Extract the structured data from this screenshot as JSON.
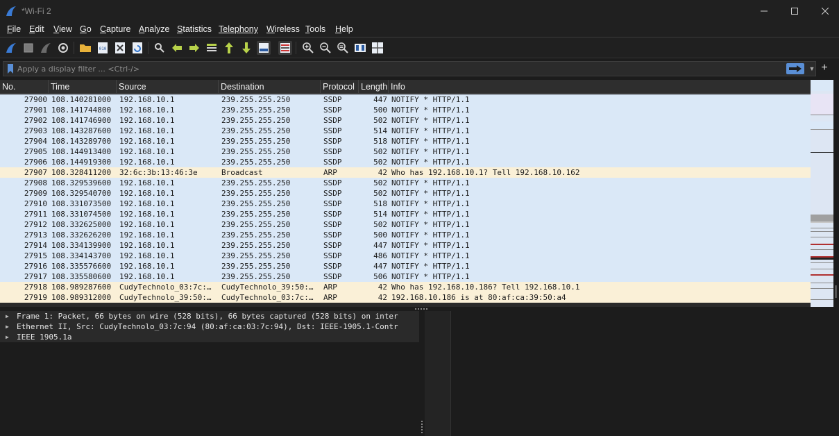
{
  "window": {
    "title": "*Wi-Fi 2"
  },
  "menu": [
    {
      "label": "File",
      "u": "F",
      "rest": "ile",
      "id": "file"
    },
    {
      "label": "Edit",
      "u": "E",
      "rest": "dit",
      "id": "edit"
    },
    {
      "label": "View",
      "u": "V",
      "rest": "iew",
      "id": "view"
    },
    {
      "label": "Go",
      "u": "G",
      "rest": "o",
      "id": "go"
    },
    {
      "label": "Capture",
      "u": "C",
      "rest": "apture",
      "id": "capture"
    },
    {
      "label": "Analyze",
      "u": "A",
      "rest": "nalyze",
      "id": "analyze"
    },
    {
      "label": "Statistics",
      "u": "S",
      "rest": "tatistics",
      "id": "statistics"
    },
    {
      "label": "Telephony",
      "u": "",
      "rest": "Telephony",
      "id": "telephony"
    },
    {
      "label": "Wireless",
      "u": "W",
      "rest": "ireless",
      "id": "wireless"
    },
    {
      "label": "Tools",
      "u": "T",
      "rest": "ools",
      "id": "tools"
    },
    {
      "label": "Help",
      "u": "H",
      "rest": "elp",
      "id": "help"
    }
  ],
  "filter": {
    "placeholder": "Apply a display filter ... <Ctrl-/>"
  },
  "columns": {
    "no": "No.",
    "time": "Time",
    "source": "Source",
    "destination": "Destination",
    "protocol": "Protocol",
    "length": "Length",
    "info": "Info"
  },
  "packets": [
    {
      "no": "27900",
      "time": "108.140281000",
      "src": "192.168.10.1",
      "dst": "239.255.255.250",
      "proto": "SSDP",
      "len": "447",
      "info": "NOTIFY * HTTP/1.1"
    },
    {
      "no": "27901",
      "time": "108.141744800",
      "src": "192.168.10.1",
      "dst": "239.255.255.250",
      "proto": "SSDP",
      "len": "500",
      "info": "NOTIFY * HTTP/1.1"
    },
    {
      "no": "27902",
      "time": "108.141746900",
      "src": "192.168.10.1",
      "dst": "239.255.255.250",
      "proto": "SSDP",
      "len": "502",
      "info": "NOTIFY * HTTP/1.1"
    },
    {
      "no": "27903",
      "time": "108.143287600",
      "src": "192.168.10.1",
      "dst": "239.255.255.250",
      "proto": "SSDP",
      "len": "514",
      "info": "NOTIFY * HTTP/1.1"
    },
    {
      "no": "27904",
      "time": "108.143289700",
      "src": "192.168.10.1",
      "dst": "239.255.255.250",
      "proto": "SSDP",
      "len": "518",
      "info": "NOTIFY * HTTP/1.1"
    },
    {
      "no": "27905",
      "time": "108.144913400",
      "src": "192.168.10.1",
      "dst": "239.255.255.250",
      "proto": "SSDP",
      "len": "502",
      "info": "NOTIFY * HTTP/1.1"
    },
    {
      "no": "27906",
      "time": "108.144919300",
      "src": "192.168.10.1",
      "dst": "239.255.255.250",
      "proto": "SSDP",
      "len": "502",
      "info": "NOTIFY * HTTP/1.1"
    },
    {
      "no": "27907",
      "time": "108.328411200",
      "src": "32:6c:3b:13:46:3e",
      "dst": "Broadcast",
      "proto": "ARP",
      "len": "42",
      "info": "Who has 192.168.10.1? Tell 192.168.10.162"
    },
    {
      "no": "27908",
      "time": "108.329539600",
      "src": "192.168.10.1",
      "dst": "239.255.255.250",
      "proto": "SSDP",
      "len": "502",
      "info": "NOTIFY * HTTP/1.1"
    },
    {
      "no": "27909",
      "time": "108.329540700",
      "src": "192.168.10.1",
      "dst": "239.255.255.250",
      "proto": "SSDP",
      "len": "502",
      "info": "NOTIFY * HTTP/1.1"
    },
    {
      "no": "27910",
      "time": "108.331073500",
      "src": "192.168.10.1",
      "dst": "239.255.255.250",
      "proto": "SSDP",
      "len": "518",
      "info": "NOTIFY * HTTP/1.1"
    },
    {
      "no": "27911",
      "time": "108.331074500",
      "src": "192.168.10.1",
      "dst": "239.255.255.250",
      "proto": "SSDP",
      "len": "514",
      "info": "NOTIFY * HTTP/1.1"
    },
    {
      "no": "27912",
      "time": "108.332625000",
      "src": "192.168.10.1",
      "dst": "239.255.255.250",
      "proto": "SSDP",
      "len": "502",
      "info": "NOTIFY * HTTP/1.1"
    },
    {
      "no": "27913",
      "time": "108.332626200",
      "src": "192.168.10.1",
      "dst": "239.255.255.250",
      "proto": "SSDP",
      "len": "500",
      "info": "NOTIFY * HTTP/1.1"
    },
    {
      "no": "27914",
      "time": "108.334139900",
      "src": "192.168.10.1",
      "dst": "239.255.255.250",
      "proto": "SSDP",
      "len": "447",
      "info": "NOTIFY * HTTP/1.1"
    },
    {
      "no": "27915",
      "time": "108.334143700",
      "src": "192.168.10.1",
      "dst": "239.255.255.250",
      "proto": "SSDP",
      "len": "486",
      "info": "NOTIFY * HTTP/1.1"
    },
    {
      "no": "27916",
      "time": "108.335576600",
      "src": "192.168.10.1",
      "dst": "239.255.255.250",
      "proto": "SSDP",
      "len": "447",
      "info": "NOTIFY * HTTP/1.1"
    },
    {
      "no": "27917",
      "time": "108.335580600",
      "src": "192.168.10.1",
      "dst": "239.255.255.250",
      "proto": "SSDP",
      "len": "506",
      "info": "NOTIFY * HTTP/1.1"
    },
    {
      "no": "27918",
      "time": "108.989287600",
      "src": "CudyTechnolo_03:7c:…",
      "dst": "CudyTechnolo_39:50:…",
      "proto": "ARP",
      "len": "42",
      "info": "Who has 192.168.10.186? Tell 192.168.10.1"
    },
    {
      "no": "27919",
      "time": "108.989312000",
      "src": "CudyTechnolo_39:50:…",
      "dst": "CudyTechnolo_03:7c:…",
      "proto": "ARP",
      "len": "42",
      "info": "192.168.10.186 is at 80:af:ca:39:50:a4"
    }
  ],
  "details": [
    "Frame 1: Packet, 66 bytes on wire (528 bits), 66 bytes captured (528 bits) on inter",
    "Ethernet II, Src: CudyTechnolo_03:7c:94 (80:af:ca:03:7c:94), Dst: IEEE-1905.1-Contr",
    "IEEE 1905.1a"
  ],
  "colors": {
    "ssdp_row": "#dae8f7",
    "arp_row": "#faf0d7",
    "accent": "#5a8fd6"
  }
}
